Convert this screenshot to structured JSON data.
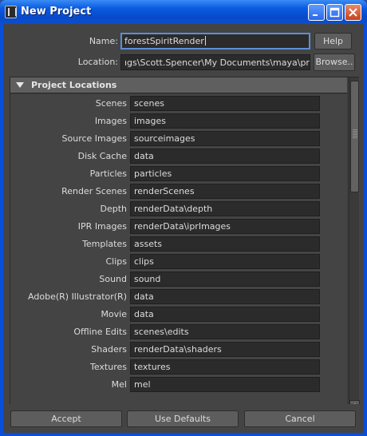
{
  "window": {
    "title": "New Project",
    "icon": "maya-app-icon"
  },
  "form": {
    "name_label": "Name:",
    "name_value": "forestSpiritRender",
    "help_label": "Help",
    "location_label": "Location:",
    "location_value": "ıgs\\Scott.Spencer\\My Documents\\maya\\projects",
    "browse_label": "Browse.."
  },
  "panel": {
    "title": "Project Locations",
    "rows": [
      {
        "label": "Scenes",
        "value": "scenes"
      },
      {
        "label": "Images",
        "value": "images"
      },
      {
        "label": "Source Images",
        "value": "sourceimages"
      },
      {
        "label": "Disk Cache",
        "value": "data"
      },
      {
        "label": "Particles",
        "value": "particles"
      },
      {
        "label": "Render Scenes",
        "value": "renderScenes"
      },
      {
        "label": "Depth",
        "value": "renderData\\depth"
      },
      {
        "label": "IPR Images",
        "value": "renderData\\iprImages"
      },
      {
        "label": "Templates",
        "value": "assets"
      },
      {
        "label": "Clips",
        "value": "clips"
      },
      {
        "label": "Sound",
        "value": "sound"
      },
      {
        "label": "Adobe(R) Illustrator(R)",
        "value": "data"
      },
      {
        "label": "Movie",
        "value": "data"
      },
      {
        "label": "Offline Edits",
        "value": "scenes\\edits"
      },
      {
        "label": "Shaders",
        "value": "renderData\\shaders"
      },
      {
        "label": "Textures",
        "value": "textures"
      },
      {
        "label": "Mel",
        "value": "mel"
      }
    ]
  },
  "buttons": {
    "accept": "Accept",
    "use_defaults": "Use Defaults",
    "cancel": "Cancel"
  },
  "colors": {
    "titlebar": "#0a5be0",
    "window_bg": "#444444",
    "field_bg": "#2b2b2b",
    "focus_border": "#5c8fd6"
  }
}
